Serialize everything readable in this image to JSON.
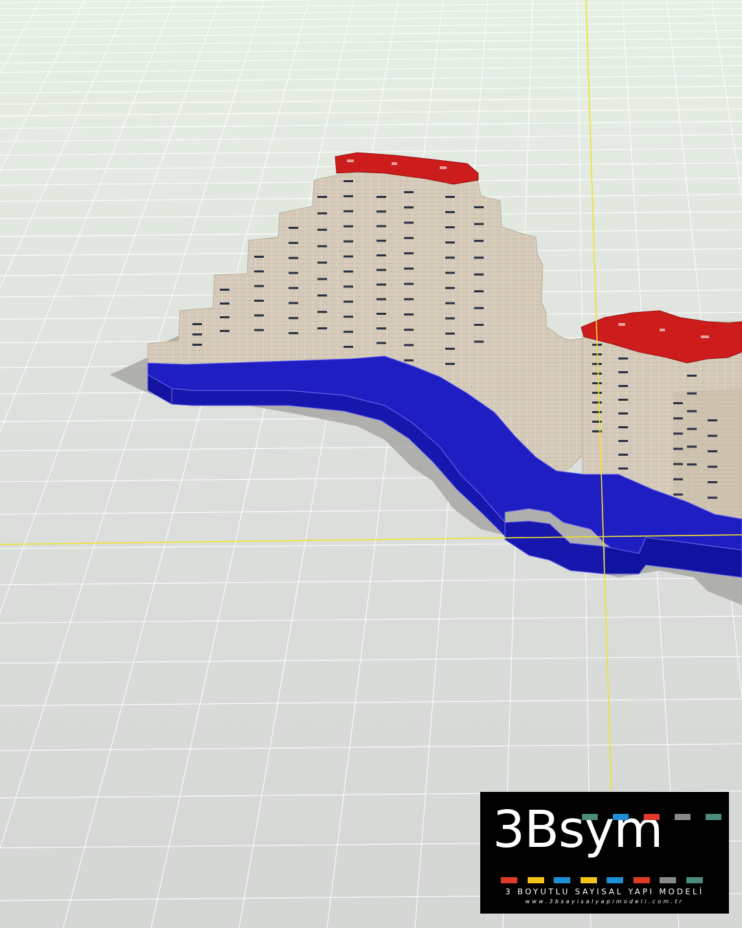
{
  "logo": {
    "wordmark": "3Bsym",
    "tagline": "3 BOYUTLU SAYISAL YAPI MODELİ",
    "url": "www.3bsayisalyapimodeli.com.tr",
    "top_squares": [
      "#4c8c7c",
      "#1f8fd6",
      "#e03a2a",
      "#8a8a8a",
      "#4c8c7c"
    ],
    "bottom_squares": [
      "#e03a2a",
      "#f2c318",
      "#1f8fd6",
      "#f2c318",
      "#1f8fd6",
      "#e03a2a",
      "#8a8a8a",
      "#4c8c7c"
    ]
  },
  "viewport": {
    "colors": {
      "sky": "#e4efe4",
      "ground": "#d8dbd8",
      "grid_line": "#ffffff",
      "axis": "#f0e22a",
      "platform": "#1a1ab8",
      "building_wall": "#d6cbbb",
      "roof": "#cc1c1c",
      "window": "#2a3240",
      "shadow": "#a3a3a0"
    }
  }
}
